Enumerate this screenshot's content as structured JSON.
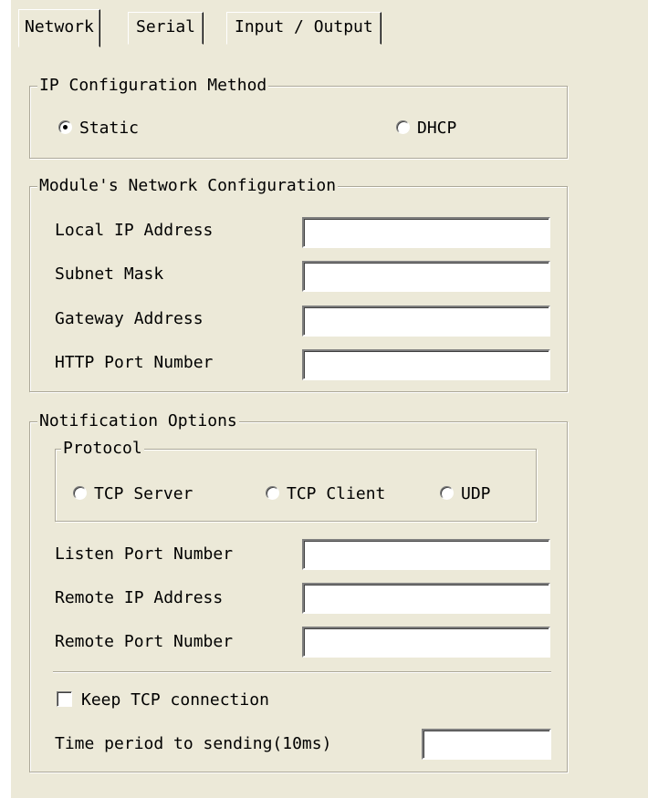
{
  "tabs": [
    {
      "label": "Network",
      "active": true
    },
    {
      "label": "Serial",
      "active": false
    },
    {
      "label": "Input / Output",
      "active": false
    }
  ],
  "ip_config": {
    "title": "IP Configuration Method",
    "static_label": "Static",
    "dhcp_label": "DHCP",
    "selected": "Static"
  },
  "module_config": {
    "title": "Module's Network Configuration",
    "local_ip_label": "Local IP Address",
    "local_ip_value": "",
    "subnet_label": "Subnet Mask",
    "subnet_value": "",
    "gateway_label": "Gateway Address",
    "gateway_value": "",
    "http_port_label": "HTTP Port Number",
    "http_port_value": ""
  },
  "notification": {
    "title": "Notification Options",
    "protocol": {
      "title": "Protocol",
      "tcp_server_label": "TCP Server",
      "tcp_client_label": "TCP Client",
      "udp_label": "UDP",
      "selected": ""
    },
    "listen_port_label": "Listen Port Number",
    "listen_port_value": "",
    "remote_ip_label": "Remote IP Address",
    "remote_ip_value": "",
    "remote_port_label": "Remote Port Number",
    "remote_port_value": "",
    "keep_tcp_label": "Keep TCP connection",
    "keep_tcp_checked": false,
    "time_period_label": "Time period to sending(10ms)",
    "time_period_value": ""
  },
  "colors": {
    "panel_bg": "#ece9d8",
    "group_border": "#aca899"
  }
}
